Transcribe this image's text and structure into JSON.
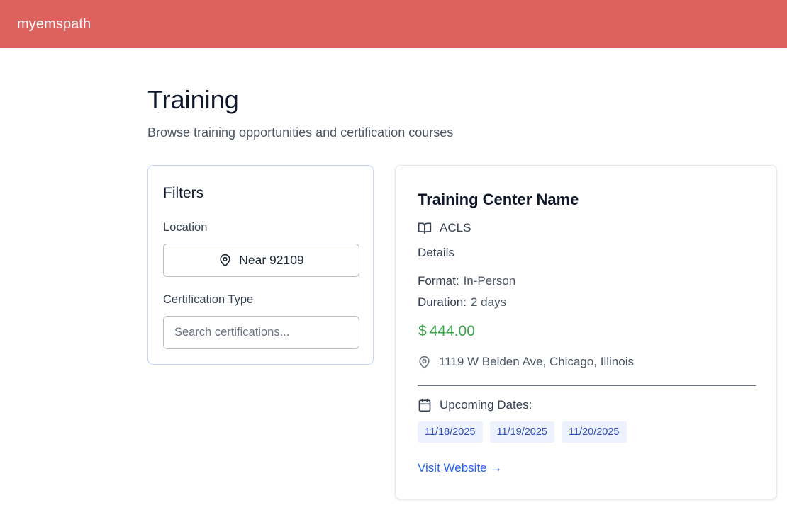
{
  "header": {
    "brand": "myemspath",
    "brand_color": "#dd625e"
  },
  "page": {
    "title": "Training",
    "subtitle": "Browse training opportunities and certification courses"
  },
  "filters": {
    "title": "Filters",
    "location_label": "Location",
    "location_value": "Near 92109",
    "location_icon": "map-pin-icon",
    "cert_type_label": "Certification Type",
    "search_placeholder": "Search certifications...",
    "search_value": ""
  },
  "card": {
    "center_name": "Training Center Name",
    "certification": "ACLS",
    "certification_icon": "book-open-icon",
    "details_heading": "Details",
    "format_label": "Format:",
    "format_value": "In-Person",
    "duration_label": "Duration:",
    "duration_value": "2 days",
    "price_symbol": "$",
    "price": "444.00",
    "price_color": "#3fa34d",
    "address": "1119 W Belden Ave, Chicago, Illinois",
    "address_icon": "map-pin-icon",
    "upcoming_label": "Upcoming Dates:",
    "upcoming_icon": "calendar-icon",
    "dates": [
      "11/18/2025",
      "11/19/2025",
      "11/20/2025"
    ],
    "visit_link": "Visit Website →",
    "link_color": "#2563eb"
  }
}
